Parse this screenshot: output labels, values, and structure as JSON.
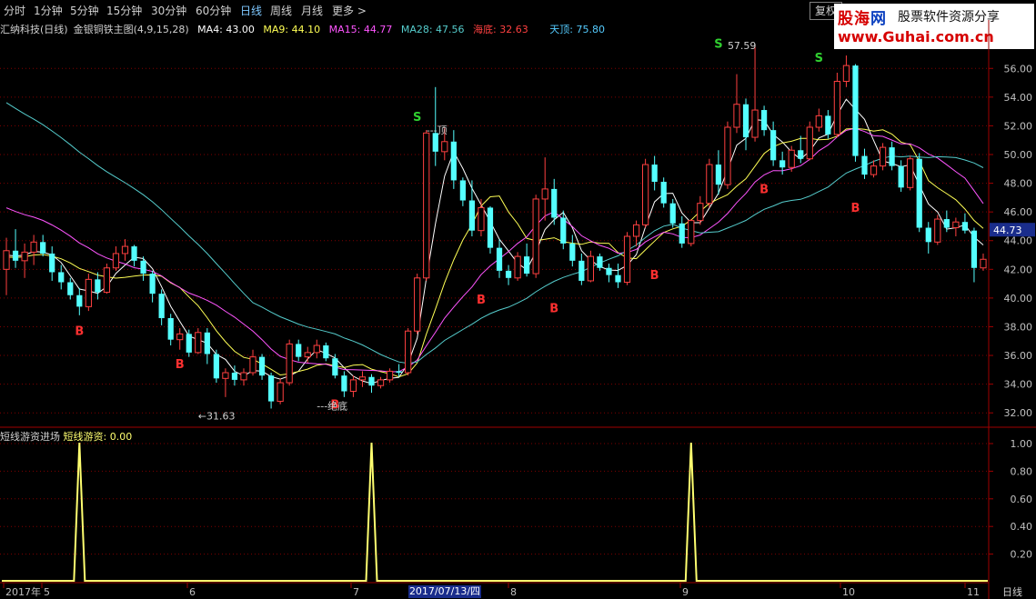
{
  "toolbar": {
    "tabs": [
      "分时",
      "1分钟",
      "5分钟",
      "15分钟",
      "30分钟",
      "60分钟",
      "日线",
      "周线",
      "月线",
      "更多 >"
    ],
    "active": "日线",
    "restore_label": "复权"
  },
  "watermark": {
    "brand_a": "股海",
    "brand_b": "网",
    "slogan": "股票软件资源分享",
    "url": "www.Guhai.com.cn"
  },
  "legend": {
    "stock": "汇纳科技(日线)",
    "indicator": "金银铜铁主图(4,9,15,28)",
    "ma4": "MA4: 43.00",
    "ma9": "MA9: 44.10",
    "ma15": "MA15: 44.77",
    "ma28": "MA28: 47.56",
    "sea_bottom": "海底: 32.63",
    "sky_top": "天顶: 75.80"
  },
  "indicator_legend": {
    "name": "短线游资进场",
    "value": "短线游资: 0.00"
  },
  "colors": {
    "up": "#ff4040",
    "down": "#54ffff",
    "ma4": "#ffffff",
    "ma9": "#ffff55",
    "ma15": "#ff55ff",
    "ma28": "#55cccc",
    "grid": "#800000",
    "axis_text": "#c0c0c0",
    "signal_buy": "#ff3030",
    "signal_sell": "#30d030",
    "pulse": "#ffff70"
  },
  "chart_data": [
    {
      "type": "candlestick",
      "title": "汇纳科技(日线)",
      "ylim": [
        31,
        57.6
      ],
      "y_ticks": [
        32,
        34,
        36,
        38,
        40,
        42,
        44,
        46,
        48,
        50,
        52,
        54,
        56
      ],
      "current_price_label": "44.73",
      "ohlc": [
        [
          42,
          44.2,
          40.2,
          43.3
        ],
        [
          43.3,
          44.8,
          42.1,
          42.6
        ],
        [
          42.6,
          43.8,
          41.4,
          43.2
        ],
        [
          43.2,
          44.4,
          42.3,
          43.9
        ],
        [
          43.9,
          44.4,
          42.9,
          43.1
        ],
        [
          43.1,
          43.6,
          41.2,
          41.8
        ],
        [
          41.8,
          42.3,
          40.6,
          41.1
        ],
        [
          41.1,
          41.4,
          39.9,
          40.2
        ],
        [
          40.2,
          40.7,
          38.8,
          39.4
        ],
        [
          39.4,
          41.7,
          39.1,
          41.3
        ],
        [
          41.3,
          41.8,
          39.9,
          40.4
        ],
        [
          40.4,
          42.4,
          40.3,
          42.1
        ],
        [
          42.1,
          43.6,
          41.9,
          43.1
        ],
        [
          43.1,
          44.1,
          42.6,
          43.6
        ],
        [
          43.6,
          43.7,
          42.2,
          42.6
        ],
        [
          42.6,
          42.9,
          41.2,
          41.7
        ],
        [
          41.7,
          41.9,
          39.7,
          40.3
        ],
        [
          40.3,
          40.6,
          38.1,
          38.6
        ],
        [
          38.6,
          38.9,
          36.7,
          37.1
        ],
        [
          37.1,
          37.9,
          36.4,
          37.5
        ],
        [
          37.5,
          37.8,
          35.9,
          36.2
        ],
        [
          36.2,
          37.9,
          36.1,
          37.6
        ],
        [
          37.6,
          37.9,
          35.4,
          36.1
        ],
        [
          36.1,
          36.4,
          34.1,
          34.4
        ],
        [
          34.4,
          35.1,
          33.1,
          34.8
        ],
        [
          34.8,
          35.3,
          33.9,
          34.3
        ],
        [
          34.3,
          35.1,
          33.9,
          34.8
        ],
        [
          34.8,
          36.4,
          34.6,
          35.9
        ],
        [
          35.9,
          36.1,
          34.3,
          34.6
        ],
        [
          34.6,
          34.8,
          32.3,
          32.8
        ],
        [
          32.8,
          34.4,
          32.6,
          34.1
        ],
        [
          34.1,
          37.1,
          33.9,
          36.8
        ],
        [
          36.8,
          37.1,
          35.6,
          35.9
        ],
        [
          35.9,
          36.6,
          35.5,
          36.2
        ],
        [
          36.2,
          37.1,
          35.8,
          36.7
        ],
        [
          36.7,
          36.9,
          35.6,
          35.8
        ],
        [
          35.8,
          36.1,
          34.4,
          34.6
        ],
        [
          34.6,
          34.9,
          33.1,
          33.5
        ],
        [
          33.5,
          34.6,
          33.1,
          34.3
        ],
        [
          34.3,
          34.9,
          33.8,
          34.5
        ],
        [
          34.5,
          34.7,
          33.4,
          33.9
        ],
        [
          33.9,
          34.5,
          33.7,
          34.3
        ],
        [
          34.3,
          35.1,
          34.1,
          34.9
        ],
        [
          34.9,
          35.4,
          34.5,
          34.8
        ],
        [
          34.8,
          37.9,
          34.6,
          37.7
        ],
        [
          37.7,
          41.7,
          37.5,
          41.4
        ],
        [
          41.4,
          51.7,
          41.2,
          51.5
        ],
        [
          51.5,
          54.7,
          49.2,
          50.2
        ],
        [
          50.2,
          51.9,
          49.6,
          50.9
        ],
        [
          50.9,
          51.7,
          47.6,
          48.2
        ],
        [
          48.2,
          48.4,
          46.4,
          46.8
        ],
        [
          46.8,
          48.2,
          44.3,
          44.7
        ],
        [
          44.7,
          46.9,
          44.3,
          46.3
        ],
        [
          46.3,
          46.4,
          43.1,
          43.5
        ],
        [
          43.5,
          44.1,
          41.4,
          41.9
        ],
        [
          41.9,
          42.3,
          40.9,
          41.4
        ],
        [
          41.4,
          43.2,
          41.2,
          42.9
        ],
        [
          42.9,
          43.8,
          41.5,
          41.7
        ],
        [
          41.7,
          47.2,
          41.4,
          46.9
        ],
        [
          46.9,
          49.8,
          45.4,
          47.6
        ],
        [
          47.6,
          48.3,
          45.1,
          45.6
        ],
        [
          45.6,
          46.1,
          43.4,
          43.8
        ],
        [
          43.8,
          44.4,
          42.2,
          42.6
        ],
        [
          42.6,
          43.1,
          40.9,
          41.2
        ],
        [
          41.2,
          43.3,
          41.1,
          42.9
        ],
        [
          42.9,
          43.1,
          41.9,
          42.1
        ],
        [
          42.1,
          42.4,
          41.1,
          41.6
        ],
        [
          41.6,
          42.4,
          40.7,
          41.1
        ],
        [
          41.1,
          44.6,
          40.9,
          44.3
        ],
        [
          44.3,
          45.4,
          43.6,
          45.1
        ],
        [
          45.1,
          49.7,
          44.9,
          49.3
        ],
        [
          49.3,
          49.9,
          47.5,
          48.1
        ],
        [
          48.1,
          48.4,
          46.3,
          46.6
        ],
        [
          46.6,
          46.9,
          44.9,
          45.2
        ],
        [
          45.2,
          45.7,
          43.5,
          43.8
        ],
        [
          43.8,
          45.5,
          43.6,
          45.4
        ],
        [
          45.4,
          47.1,
          45.1,
          46.6
        ],
        [
          46.6,
          49.7,
          46.3,
          49.3
        ],
        [
          49.3,
          50.3,
          47.2,
          47.9
        ],
        [
          47.9,
          52.3,
          47.6,
          51.9
        ],
        [
          51.9,
          55.6,
          51.5,
          53.5
        ],
        [
          53.5,
          53.9,
          50.3,
          51.2
        ],
        [
          51.2,
          57.6,
          50.9,
          53.1
        ],
        [
          53.1,
          53.4,
          51.3,
          51.7
        ],
        [
          51.7,
          52.3,
          49.2,
          49.6
        ],
        [
          49.6,
          50.2,
          48.6,
          49.1
        ],
        [
          49.1,
          50.6,
          48.8,
          50.3
        ],
        [
          50.3,
          51.3,
          49.4,
          49.7
        ],
        [
          49.7,
          52.3,
          49.6,
          51.9
        ],
        [
          51.9,
          53.2,
          51.6,
          52.7
        ],
        [
          52.7,
          53.1,
          51.1,
          51.4
        ],
        [
          51.4,
          55.7,
          51.2,
          55.1
        ],
        [
          55.1,
          56.9,
          54.7,
          56.2
        ],
        [
          56.2,
          56.3,
          49.5,
          49.9
        ],
        [
          49.9,
          50.4,
          48.3,
          48.6
        ],
        [
          48.6,
          49.6,
          48.4,
          49.2
        ],
        [
          49.2,
          50.8,
          48.9,
          50.5
        ],
        [
          50.5,
          50.9,
          48.9,
          49.2
        ],
        [
          49.2,
          49.6,
          47.4,
          47.7
        ],
        [
          47.7,
          49.9,
          47.5,
          49.7
        ],
        [
          49.7,
          50.1,
          44.6,
          44.9
        ],
        [
          44.9,
          45.3,
          43.1,
          43.9
        ],
        [
          43.9,
          45.8,
          43.7,
          45.5
        ],
        [
          45.5,
          46.1,
          44.6,
          44.9
        ],
        [
          44.9,
          45.6,
          44.3,
          45.3
        ],
        [
          45.3,
          45.9,
          44.5,
          44.7
        ],
        [
          44.7,
          44.9,
          41.1,
          42.1
        ],
        [
          42.1,
          43.1,
          41.9,
          42.7
        ]
      ],
      "ma_series": [
        {
          "name": "MA4",
          "color": "#ffffff",
          "start": [
            0,
            42.9
          ],
          "end": [
            109,
            43.0
          ]
        },
        {
          "name": "MA9",
          "color": "#ffff55",
          "start": [
            0,
            42.8
          ],
          "end": [
            109,
            44.1
          ]
        },
        {
          "name": "MA15",
          "color": "#ff55ff",
          "start": [
            0,
            46.5
          ],
          "end": [
            109,
            44.77
          ]
        },
        {
          "name": "MA28",
          "color": "#55cccc",
          "start": [
            0,
            54.0
          ],
          "end": [
            109,
            47.56
          ]
        }
      ],
      "annotations": [
        {
          "label": "B",
          "kind": "buy",
          "at": [
            8,
            38.3
          ]
        },
        {
          "label": "B",
          "kind": "buy",
          "at": [
            19,
            36.0
          ]
        },
        {
          "label": "B",
          "kind": "buy",
          "at": [
            36,
            33.2
          ]
        },
        {
          "label": "B",
          "kind": "buy",
          "at": [
            52,
            40.5
          ]
        },
        {
          "label": "B",
          "kind": "buy",
          "at": [
            60,
            39.9
          ]
        },
        {
          "label": "B",
          "kind": "buy",
          "at": [
            71,
            42.2
          ]
        },
        {
          "label": "B",
          "kind": "buy",
          "at": [
            83,
            48.2
          ]
        },
        {
          "label": "B",
          "kind": "buy",
          "at": [
            93,
            46.9
          ]
        },
        {
          "label": "S",
          "kind": "sell",
          "at": [
            45,
            52.1
          ]
        },
        {
          "label": "S",
          "kind": "sell",
          "at": [
            78,
            57.2
          ]
        },
        {
          "label": "S",
          "kind": "sell",
          "at": [
            89,
            56.2
          ]
        },
        {
          "label": "---顶",
          "kind": "note",
          "at": [
            46,
            51.7
          ]
        },
        {
          "label": "57.59",
          "kind": "note",
          "at": [
            79,
            57.6
          ]
        },
        {
          "label": "←31.63",
          "kind": "note",
          "at": [
            21,
            31.8
          ]
        },
        {
          "label": "---绝底",
          "kind": "note",
          "at": [
            34,
            32.5
          ]
        }
      ],
      "x_labels": [
        "2017年",
        "5",
        "6",
        "7",
        "2017/07/13/四",
        "8",
        "9",
        "10",
        "11"
      ],
      "corner_label": "日线"
    },
    {
      "type": "line",
      "title": "短线游资进场",
      "ylim": [
        0,
        1.0
      ],
      "y_ticks": [
        0.2,
        0.4,
        0.6,
        0.8,
        1.0
      ],
      "series": [
        {
          "name": "短线游资",
          "values_at_pulses": [
            1,
            1,
            1
          ],
          "pulse_x": [
            8,
            40,
            75
          ]
        }
      ]
    }
  ]
}
